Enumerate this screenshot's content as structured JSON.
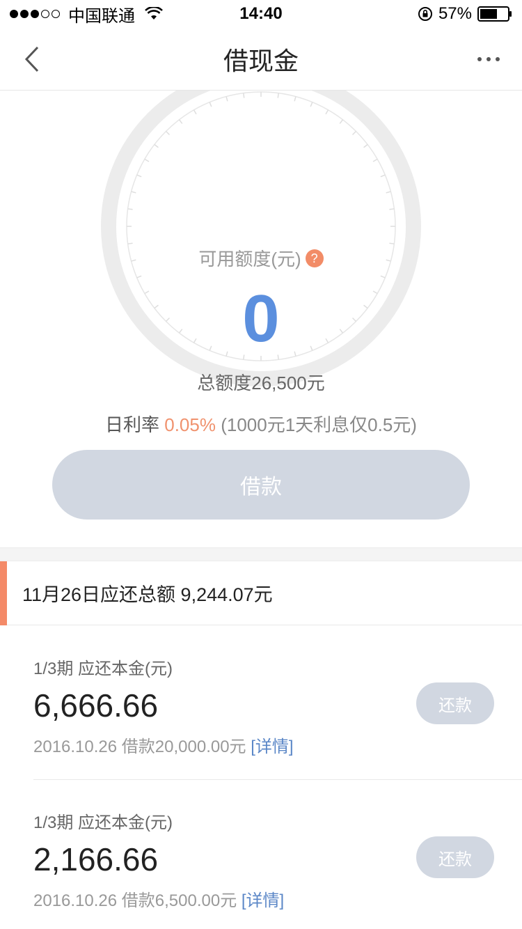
{
  "status_bar": {
    "carrier": "中国联通",
    "time": "14:40",
    "battery": "57%"
  },
  "nav": {
    "title": "借现金"
  },
  "credit": {
    "available_label": "可用额度(元)",
    "help_symbol": "?",
    "available_amount": "0",
    "total_quota": "总额度26,500元"
  },
  "rate": {
    "label": "日利率 ",
    "value": "0.05%",
    "note": " (1000元1天利息仅0.5元)"
  },
  "borrow_button": {
    "label": "借款"
  },
  "due": {
    "summary": "11月26日应还总额 9,244.07元"
  },
  "loans": [
    {
      "period": "1/3期 应还本金(元)",
      "amount": "6,666.66",
      "meta": "2016.10.26 借款20,000.00元 ",
      "detail_label": "[详情]",
      "repay_label": "还款"
    },
    {
      "period": "1/3期 应还本金(元)",
      "amount": "2,166.66",
      "meta": "2016.10.26 借款6,500.00元 ",
      "detail_label": "[详情]",
      "repay_label": "还款"
    }
  ],
  "colors": {
    "accent_orange": "#f48a68",
    "amount_blue": "#5b8fde",
    "button_disabled": "#d1d7e1",
    "link_blue": "#5b87c7"
  }
}
